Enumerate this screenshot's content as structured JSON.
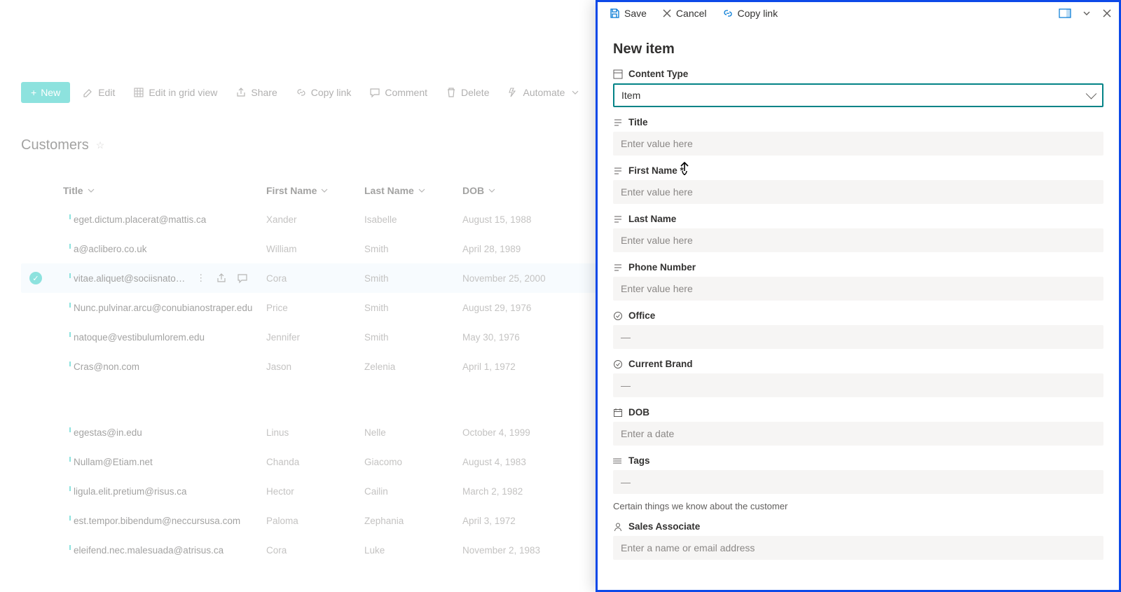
{
  "toolbar": {
    "new_label": "New",
    "buttons": [
      {
        "label": "Edit",
        "icon": "pencil-icon"
      },
      {
        "label": "Edit in grid view",
        "icon": "grid-icon"
      },
      {
        "label": "Share",
        "icon": "share-icon"
      },
      {
        "label": "Copy link",
        "icon": "link-icon"
      },
      {
        "label": "Comment",
        "icon": "comment-icon"
      },
      {
        "label": "Delete",
        "icon": "trash-icon"
      },
      {
        "label": "Automate",
        "icon": "flow-icon"
      }
    ],
    "more": "⋯"
  },
  "list": {
    "name": "Customers",
    "columns": [
      "Title",
      "First Name",
      "Last Name",
      "DOB"
    ],
    "rows": [
      {
        "title": "eget.dictum.placerat@mattis.ca",
        "first": "Xander",
        "last": "Isabelle",
        "dob": "August 15, 1988"
      },
      {
        "title": "a@aclibero.co.uk",
        "first": "William",
        "last": "Smith",
        "dob": "April 28, 1989"
      },
      {
        "title": "vitae.aliquet@sociisnato…",
        "first": "Cora",
        "last": "Smith",
        "dob": "November 25, 2000",
        "selected": true
      },
      {
        "title": "Nunc.pulvinar.arcu@conubianostraper.edu",
        "first": "Price",
        "last": "Smith",
        "dob": "August 29, 1976"
      },
      {
        "title": "natoque@vestibulumlorem.edu",
        "first": "Jennifer",
        "last": "Smith",
        "dob": "May 30, 1976"
      },
      {
        "title": "Cras@non.com",
        "first": "Jason",
        "last": "Zelenia",
        "dob": "April 1, 1972"
      }
    ],
    "rows2": [
      {
        "title": "egestas@in.edu",
        "first": "Linus",
        "last": "Nelle",
        "dob": "October 4, 1999"
      },
      {
        "title": "Nullam@Etiam.net",
        "first": "Chanda",
        "last": "Giacomo",
        "dob": "August 4, 1983"
      },
      {
        "title": "ligula.elit.pretium@risus.ca",
        "first": "Hector",
        "last": "Cailin",
        "dob": "March 2, 1982"
      },
      {
        "title": "est.tempor.bibendum@neccursusa.com",
        "first": "Paloma",
        "last": "Zephania",
        "dob": "April 3, 1972"
      },
      {
        "title": "eleifend.nec.malesuada@atrisus.ca",
        "first": "Cora",
        "last": "Luke",
        "dob": "November 2, 1983"
      }
    ]
  },
  "panel": {
    "toolbar": {
      "save": "Save",
      "cancel": "Cancel",
      "copy_link": "Copy link"
    },
    "title": "New item",
    "content_type": {
      "label": "Content Type",
      "value": "Item"
    },
    "title_field": {
      "label": "Title",
      "placeholder": "Enter value here"
    },
    "first_name": {
      "label": "First Name *",
      "placeholder": "Enter value here"
    },
    "last_name": {
      "label": "Last Name",
      "placeholder": "Enter value here"
    },
    "phone": {
      "label": "Phone Number",
      "placeholder": "Enter value here"
    },
    "office": {
      "label": "Office",
      "placeholder": "—"
    },
    "brand": {
      "label": "Current Brand",
      "placeholder": "—"
    },
    "dob": {
      "label": "DOB",
      "placeholder": "Enter a date"
    },
    "tags": {
      "label": "Tags",
      "placeholder": "—",
      "helper": "Certain things we know about the customer"
    },
    "sales": {
      "label": "Sales Associate",
      "placeholder": "Enter a name or email address"
    }
  }
}
